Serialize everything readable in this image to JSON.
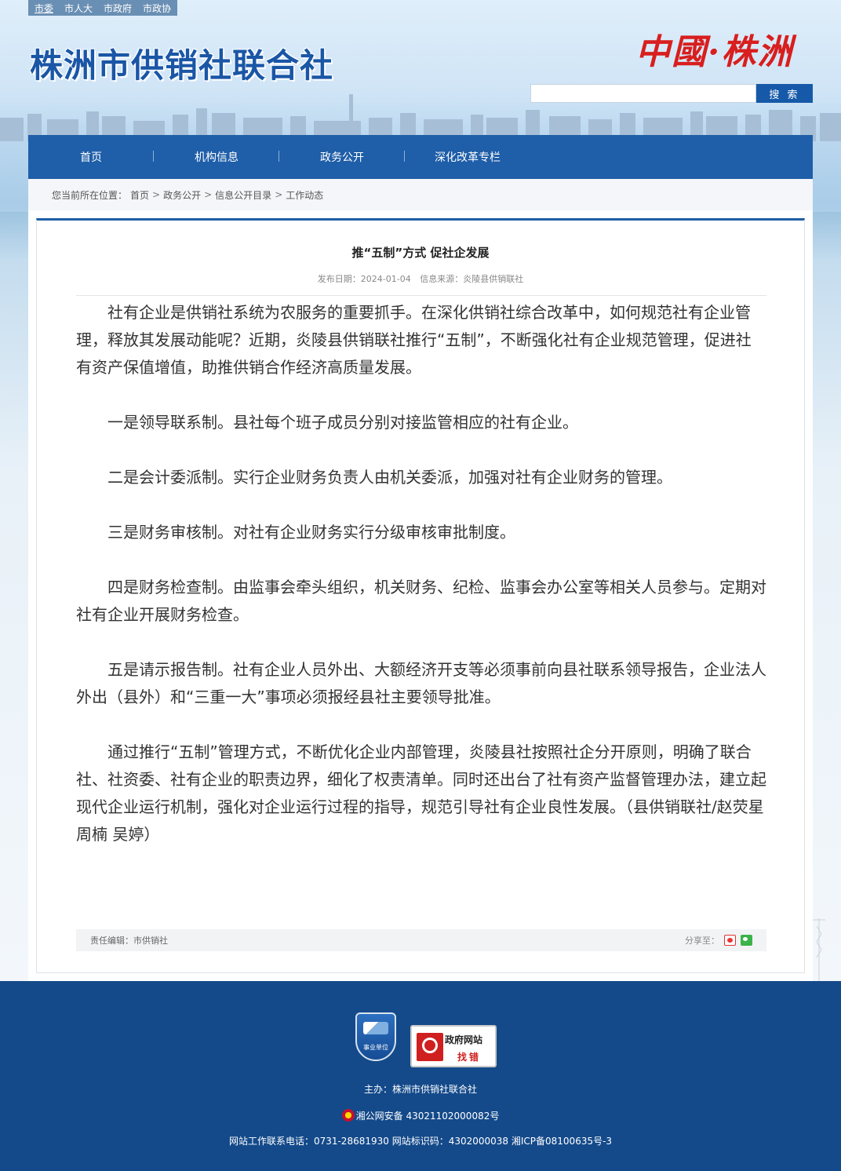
{
  "top_links": [
    "市委",
    "市人大",
    "市政府",
    "市政协"
  ],
  "site_title": "株洲市供销社联合社",
  "brand_mark": "中國·株洲",
  "search": {
    "placeholder": "",
    "button_label": "搜 索"
  },
  "nav": [
    "首页",
    "机构信息",
    "政务公开",
    "深化改革专栏"
  ],
  "breadcrumb": {
    "prefix": "您当前所在位置：",
    "items": [
      "首页",
      "政务公开",
      "信息公开目录",
      "工作动态"
    ],
    "separator": ">"
  },
  "article": {
    "title": "推“五制”方式 促社企发展",
    "publish_date_label": "发布日期：2024-01-04",
    "source_label": "信息来源：炎陵县供销联社",
    "paragraphs": [
      "社有企业是供销社系统为农服务的重要抓手。在深化供销社综合改革中，如何规范社有企业管理，释放其发展动能呢？近期，炎陵县供销联社推行“五制”，不断强化社有企业规范管理，促进社有资产保值增值，助推供销合作经济高质量发展。",
      "一是领导联系制。县社每个班子成员分别对接监管相应的社有企业。",
      "二是会计委派制。实行企业财务负责人由机关委派，加强对社有企业财务的管理。",
      "三是财务审核制。对社有企业财务实行分级审核审批制度。",
      "四是财务检查制。由监事会牵头组织，机关财务、纪检、监事会办公室等相关人员参与。定期对社有企业开展财务检查。",
      "五是请示报告制。社有企业人员外出、大额经济开支等必须事前向县社联系领导报告，企业法人外出（县外）和“三重一大”事项必须报经县社主要领导批准。",
      "通过推行“五制”管理方式，不断优化企业内部管理，炎陵县社按照社企分开原则，明确了联合社、社资委、社有企业的职责边界，细化了权责清单。同时还出台了社有资产监督管理办法，建立起现代企业运行机制，强化对企业运行过程的指导，规范引导社有企业良性发展。（县供销联社/赵荧星 周楠 吴婷）"
    ],
    "editor_label": "责任编辑：市供销社",
    "share_label": "分享至："
  },
  "footer": {
    "badge_text": "事业单位",
    "error_badge_line1": "政府网站",
    "error_badge_line2": "找错",
    "sponsor": "主办：株洲市供销社联合社",
    "police_record": "湘公网安备 43021102000082号",
    "contact": "网站工作联系电话：0731-28681930    网站标识码：4302000038 湘ICP备08100635号-3"
  },
  "colors": {
    "primary": "#1f5ea8",
    "footer": "#144a8a",
    "brand_red": "#d81e1e"
  }
}
